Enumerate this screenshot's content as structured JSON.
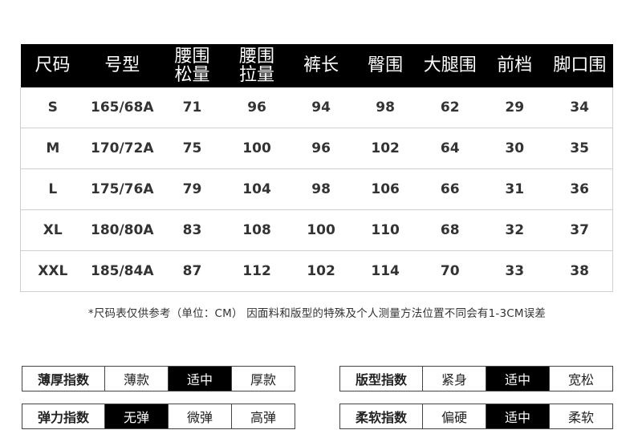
{
  "table": {
    "headers": [
      "尺码",
      "号型",
      "腰围\n松量",
      "腰围\n拉量",
      "裤长",
      "臀围",
      "大腿围",
      "前档",
      "脚口围"
    ],
    "rows": [
      [
        "S",
        "165/68A",
        "71",
        "96",
        "94",
        "98",
        "62",
        "29",
        "34"
      ],
      [
        "M",
        "170/72A",
        "75",
        "100",
        "96",
        "102",
        "64",
        "30",
        "35"
      ],
      [
        "L",
        "175/76A",
        "79",
        "104",
        "98",
        "106",
        "66",
        "31",
        "36"
      ],
      [
        "XL",
        "180/80A",
        "83",
        "108",
        "100",
        "110",
        "68",
        "32",
        "37"
      ],
      [
        "XXL",
        "185/84A",
        "87",
        "112",
        "102",
        "114",
        "70",
        "33",
        "38"
      ]
    ]
  },
  "note": "*尺码表仅供参考（单位：CM） 因面料和版型的特殊及个人测量方法位置不同会有1-3CM误差",
  "indices": [
    {
      "label": "薄厚指数",
      "options": [
        "薄款",
        "适中",
        "厚款"
      ],
      "selected": 1
    },
    {
      "label": "版型指数",
      "options": [
        "紧身",
        "适中",
        "宽松"
      ],
      "selected": 1
    },
    {
      "label": "弹力指数",
      "options": [
        "无弹",
        "微弹",
        "高弹"
      ],
      "selected": 0
    },
    {
      "label": "柔软指数",
      "options": [
        "偏硬",
        "适中",
        "柔软"
      ],
      "selected": 1
    }
  ],
  "colors": {
    "header_bg": "#000000",
    "header_text": "#ffffff",
    "selected_bg": "#000000"
  }
}
